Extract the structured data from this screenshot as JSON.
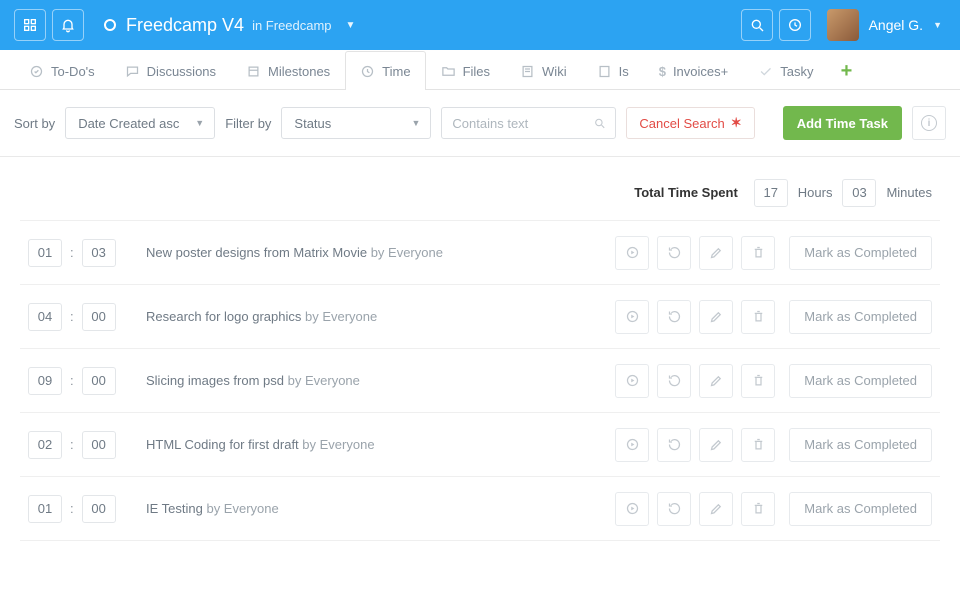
{
  "header": {
    "project_name": "Freedcamp V4",
    "project_sub": "in Freedcamp",
    "user_name": "Angel G."
  },
  "tabs": [
    {
      "label": "To-Do's"
    },
    {
      "label": "Discussions"
    },
    {
      "label": "Milestones"
    },
    {
      "label": "Time"
    },
    {
      "label": "Files"
    },
    {
      "label": "Wiki"
    },
    {
      "label": "Is"
    },
    {
      "label": "Invoices+"
    },
    {
      "label": "Tasky"
    }
  ],
  "filter": {
    "sort_by_label": "Sort by",
    "sort_value": "Date Created asc",
    "filter_by_label": "Filter by",
    "status_value": "Status",
    "search_placeholder": "Contains text",
    "cancel_label": "Cancel Search",
    "add_button": "Add Time Task"
  },
  "total": {
    "label": "Total Time Spent",
    "hours": "17",
    "hours_unit": "Hours",
    "minutes": "03",
    "minutes_unit": "Minutes"
  },
  "by_prefix": "by ",
  "mark_label": "Mark as Completed",
  "rows": [
    {
      "hh": "01",
      "mm": "03",
      "title": "New poster designs from Matrix Movie",
      "by": "Everyone"
    },
    {
      "hh": "04",
      "mm": "00",
      "title": "Research for logo graphics",
      "by": "Everyone"
    },
    {
      "hh": "09",
      "mm": "00",
      "title": "Slicing images from psd",
      "by": "Everyone"
    },
    {
      "hh": "02",
      "mm": "00",
      "title": "HTML Coding for first draft",
      "by": "Everyone"
    },
    {
      "hh": "01",
      "mm": "00",
      "title": "IE Testing",
      "by": "Everyone"
    }
  ]
}
